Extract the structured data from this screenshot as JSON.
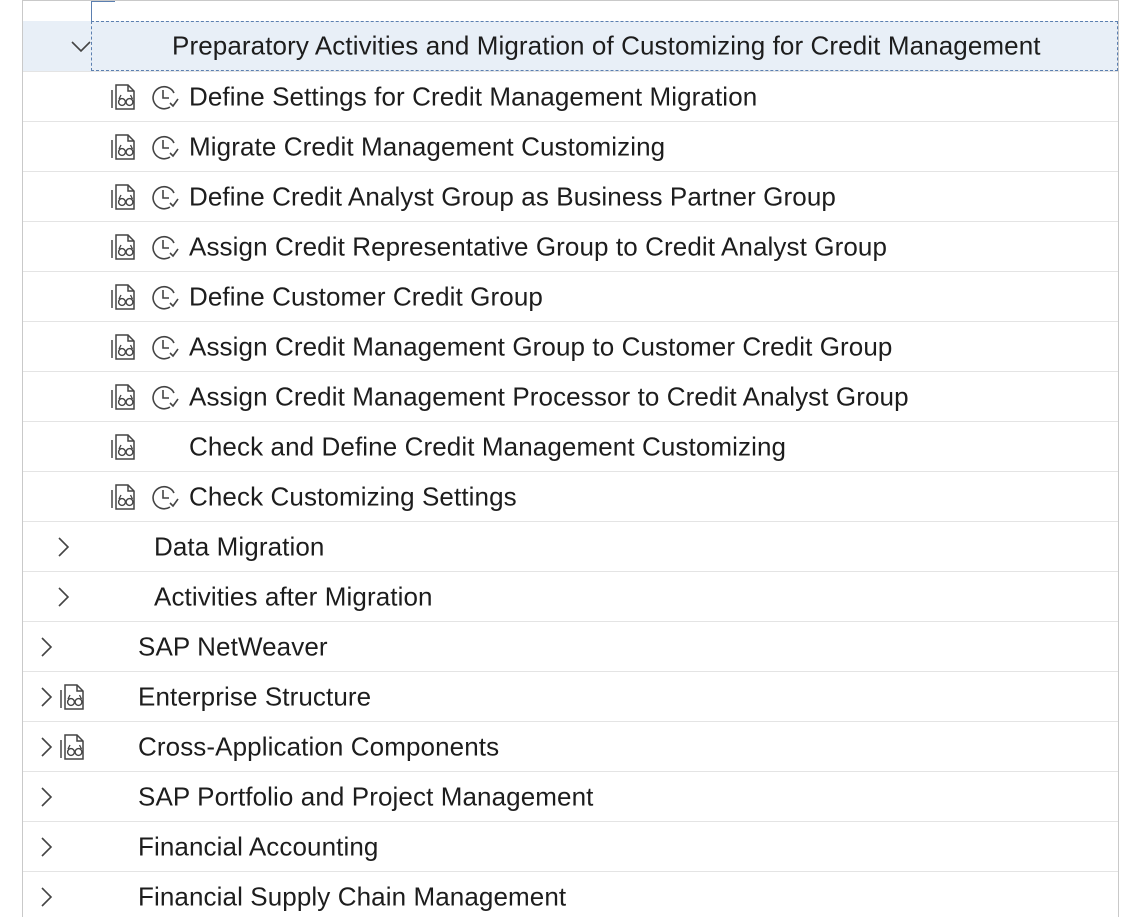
{
  "tree": {
    "selected_node": {
      "label": "Preparatory Activities and Migration of Customizing for Credit Management",
      "expanded": true
    },
    "activities": [
      {
        "label": "Define Settings for Credit Management Migration",
        "icons": [
          "documentation-icon",
          "activity-status-icon"
        ]
      },
      {
        "label": "Migrate Credit Management Customizing",
        "icons": [
          "documentation-icon",
          "activity-status-icon"
        ]
      },
      {
        "label": "Define Credit Analyst Group as Business Partner Group",
        "icons": [
          "documentation-icon",
          "activity-status-icon"
        ]
      },
      {
        "label": "Assign Credit Representative Group to Credit Analyst Group",
        "icons": [
          "documentation-icon",
          "activity-status-icon"
        ]
      },
      {
        "label": "Define Customer Credit Group",
        "icons": [
          "documentation-icon",
          "activity-status-icon"
        ]
      },
      {
        "label": "Assign Credit Management Group to Customer Credit Group",
        "icons": [
          "documentation-icon",
          "activity-status-icon"
        ]
      },
      {
        "label": "Assign Credit Management Processor to Credit Analyst Group",
        "icons": [
          "documentation-icon",
          "activity-status-icon"
        ]
      },
      {
        "label": "Check and Define Credit Management Customizing",
        "icons": [
          "documentation-icon"
        ]
      },
      {
        "label": "Check Customizing Settings",
        "icons": [
          "documentation-icon",
          "activity-status-icon"
        ]
      }
    ],
    "sibling_nodes": [
      {
        "label": "Data Migration",
        "expanded": false
      },
      {
        "label": "Activities after Migration",
        "expanded": false
      }
    ],
    "top_nodes": [
      {
        "label": "SAP NetWeaver",
        "expanded": false,
        "has_doc_icon": false
      },
      {
        "label": "Enterprise Structure",
        "expanded": false,
        "has_doc_icon": true
      },
      {
        "label": "Cross-Application Components",
        "expanded": false,
        "has_doc_icon": true
      },
      {
        "label": "SAP Portfolio and Project Management",
        "expanded": false,
        "has_doc_icon": false
      },
      {
        "label": "Financial Accounting",
        "expanded": false,
        "has_doc_icon": false
      },
      {
        "label": "Financial Supply Chain Management",
        "expanded": false,
        "has_doc_icon": false
      }
    ]
  },
  "colors": {
    "selected_background": "#e8eff7",
    "focus_border": "#5b7fb0",
    "icon_stroke": "#444444",
    "text": "#1d1d1d"
  }
}
